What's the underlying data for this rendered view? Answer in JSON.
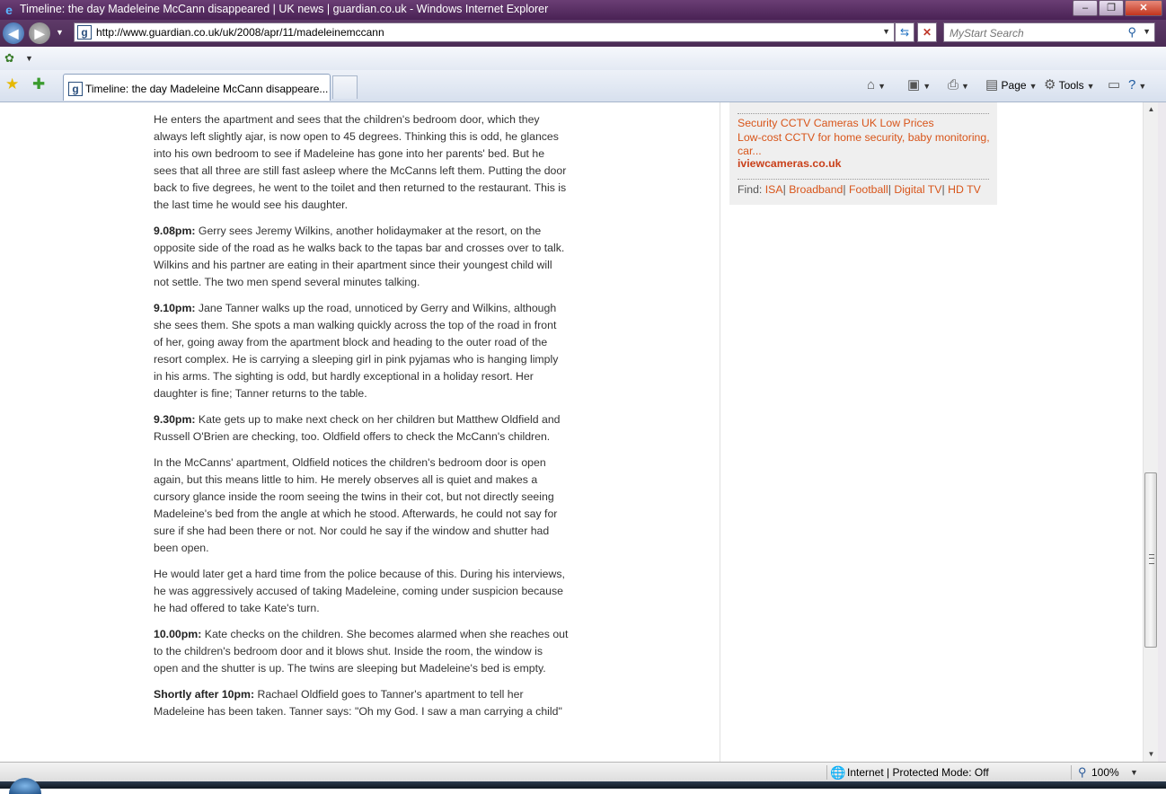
{
  "window": {
    "title": "Timeline: the day Madeleine McCann disappeared | UK news | guardian.co.uk - Windows Internet Explorer",
    "minimize": "–",
    "maximize": "❐",
    "close": "✕"
  },
  "address_bar": {
    "url": "http://www.guardian.co.uk/uk/2008/apr/11/madeleinemccann",
    "search_placeholder": "MyStart Search"
  },
  "tab": {
    "title": "Timeline: the day Madeleine McCann disappeare..."
  },
  "command_bar": {
    "page_label": "Page",
    "tools_label": "Tools"
  },
  "article": {
    "paragraphs": [
      {
        "time": "",
        "text": "He enters the apartment and sees that the children's bedroom door, which they always left slightly ajar, is now open to 45 degrees. Thinking this is odd, he glances into his own bedroom to see if Madeleine has gone into her parents' bed. But he sees that all three are still fast asleep where the McCanns left them. Putting the door back to five degrees, he went to the toilet and then returned to the restaurant. This is the last time he would see his daughter."
      },
      {
        "time": "9.08pm:",
        "text": " Gerry sees Jeremy Wilkins, another holidaymaker at the resort, on the opposite side of the road as he walks back to the tapas bar and crosses over to talk. Wilkins and his partner are eating in their apartment since their youngest child will not settle. The two men spend several minutes talking."
      },
      {
        "time": "9.10pm:",
        "text": " Jane Tanner walks up the road, unnoticed by Gerry and Wilkins, although she sees them. She spots a man walking quickly across the top of the road in front of her, going away from the apartment block and heading to the outer road of the resort complex. He is carrying a sleeping girl in pink pyjamas who is hanging limply in his arms. The sighting is odd, but hardly exceptional in a holiday resort. Her daughter is fine; Tanner returns to the table."
      },
      {
        "time": "9.30pm:",
        "text": " Kate gets up to make next check on her children but Matthew Oldfield and Russell O'Brien are checking, too. Oldfield offers to check the McCann's children."
      },
      {
        "time": "",
        "text": "In the McCanns' apartment, Oldfield notices the children's bedroom door is open again, but this means little to him. He merely observes all is quiet and makes a cursory glance inside the room seeing the twins in their cot, but not directly seeing Madeleine's bed from the angle at which he stood. Afterwards, he could not say for sure if she had been there or not. Nor could he say if the window and shutter had been open."
      },
      {
        "time": "",
        "text": "He would later get a hard time from the police because of this. During his interviews, he was aggressively accused of taking Madeleine, coming under suspicion because he had offered to take Kate's turn."
      },
      {
        "time": "10.00pm:",
        "text": " Kate checks on the children. She becomes alarmed when she reaches out to the children's bedroom door and it blows shut. Inside the room, the window is open and the shutter is up. The twins are sleeping but Madeleine's bed is empty."
      },
      {
        "time": "Shortly after 10pm:",
        "text": " Rachael Oldfield goes to Tanner's apartment to tell her Madeleine has been taken. Tanner says: \"Oh my God. I saw a man carrying a child\""
      }
    ]
  },
  "sidebar": {
    "ad_title": "Security CCTV Cameras UK Low Prices",
    "ad_description": "Low-cost CCTV for home security, baby monitoring, car...",
    "ad_domain": "iviewcameras.co.uk",
    "find_label": "Find: ",
    "find_links": [
      "ISA",
      "Broadband",
      "Football",
      "Digital TV",
      "HD TV"
    ]
  },
  "status_bar": {
    "zone": "Internet | Protected Mode: Off",
    "zoom": "100%"
  }
}
